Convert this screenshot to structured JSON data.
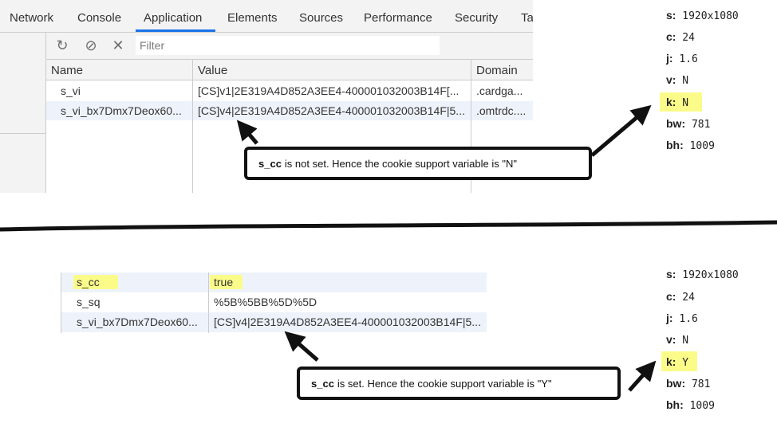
{
  "devtools": {
    "tabs": [
      "Network",
      "Console",
      "Application",
      "Elements",
      "Sources",
      "Performance",
      "Security",
      "Ta"
    ],
    "active_tab": "Application",
    "toolbar": {
      "filter_placeholder": "Filter"
    },
    "columns": [
      "Name",
      "Value",
      "Domain"
    ],
    "rows": [
      {
        "name": "s_vi",
        "value": "[CS]v1|2E319A4D852A3EE4-400001032003B14F[...",
        "domain": ".cardga..."
      },
      {
        "name": "s_vi_bx7Dmx7Deox60...",
        "value": "[CS]v4|2E319A4D852A3EE4-400001032003B14F|5...",
        "domain": ".omtrdc...."
      }
    ]
  },
  "top_vars": [
    {
      "key": "s:",
      "value": "1920x1080"
    },
    {
      "key": "c:",
      "value": "24"
    },
    {
      "key": "j:",
      "value": "1.6"
    },
    {
      "key": "v:",
      "value": "N"
    },
    {
      "key": "k:",
      "value": "N"
    },
    {
      "key": "bw:",
      "value": "781"
    },
    {
      "key": "bh:",
      "value": "1009"
    }
  ],
  "top_callout": {
    "bold": "s_cc",
    "text": "is not set. Hence the cookie support variable is \"N\""
  },
  "bottom_rows": [
    {
      "name": "s_cc",
      "value": "true"
    },
    {
      "name": "s_sq",
      "value": "%5B%5BB%5D%5D"
    },
    {
      "name": "s_vi_bx7Dmx7Deox60...",
      "value": "[CS]v4|2E319A4D852A3EE4-400001032003B14F|5..."
    }
  ],
  "bottom_vars": [
    {
      "key": "s:",
      "value": "1920x1080"
    },
    {
      "key": "c:",
      "value": "24"
    },
    {
      "key": "j:",
      "value": "1.6"
    },
    {
      "key": "v:",
      "value": "N"
    },
    {
      "key": "k:",
      "value": "Y"
    },
    {
      "key": "bw:",
      "value": "781"
    },
    {
      "key": "bh:",
      "value": "1009"
    }
  ],
  "bottom_callout": {
    "bold": "s_cc",
    "text": "is set. Hence the cookie support variable is \"Y\""
  },
  "colors": {
    "highlight": "#fbfb8a",
    "tab_underline": "#1a73e8",
    "arrow": "#111111"
  }
}
